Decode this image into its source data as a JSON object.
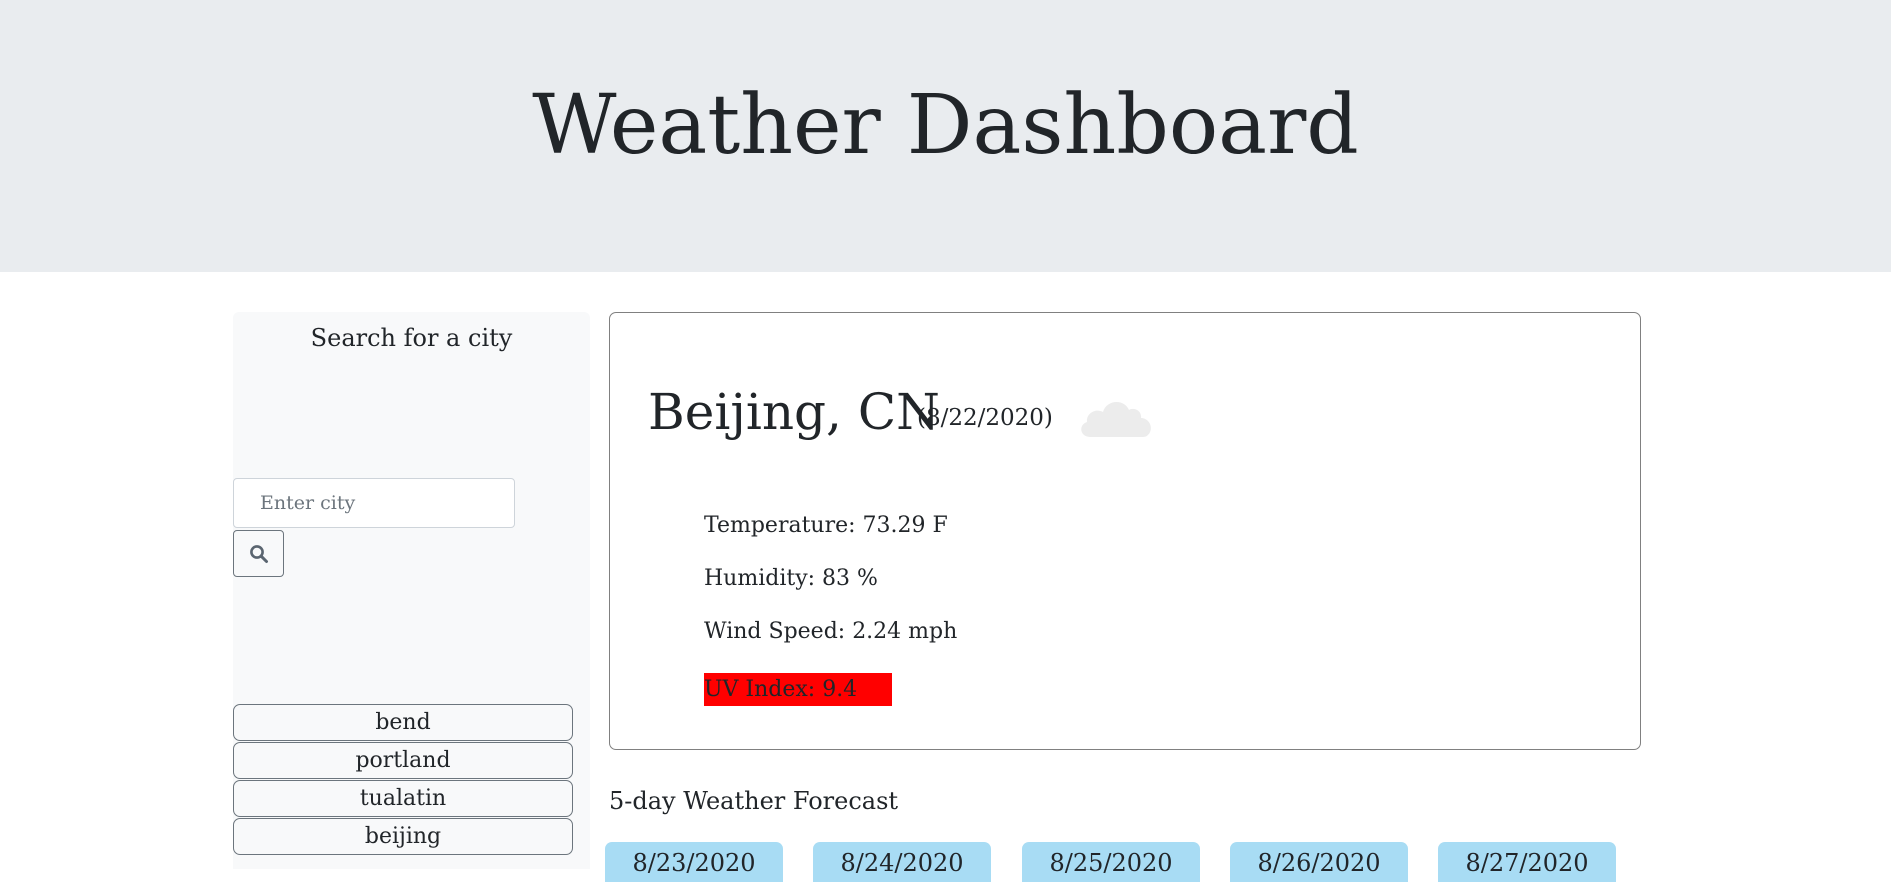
{
  "header": {
    "title": "Weather Dashboard"
  },
  "sidebar": {
    "title": "Search for a city",
    "search_input": {
      "placeholder": "Enter city",
      "value": ""
    },
    "search_button_icon": "search-icon",
    "history": [
      {
        "label": "bend"
      },
      {
        "label": "portland"
      },
      {
        "label": "tualatin"
      },
      {
        "label": "beijing"
      }
    ]
  },
  "current": {
    "city": "Beijing, CN",
    "date": "(8/22/2020)",
    "icon": "cloud-icon",
    "temperature": "Temperature: 73.29 F",
    "humidity": "Humidity: 83 %",
    "wind_speed": "Wind Speed: 2.24 mph",
    "uv_index": "UV Index: 9.4",
    "uv_color": "#ff0000"
  },
  "forecast": {
    "title": "5-day Weather Forecast",
    "days": [
      {
        "date": "8/23/2020"
      },
      {
        "date": "8/24/2020"
      },
      {
        "date": "8/25/2020"
      },
      {
        "date": "8/26/2020"
      },
      {
        "date": "8/27/2020"
      }
    ]
  },
  "colors": {
    "jumbotron_bg": "#e9ecef",
    "sidebar_bg": "#f8f9fa",
    "forecast_card_bg": "#a8dcf4"
  }
}
